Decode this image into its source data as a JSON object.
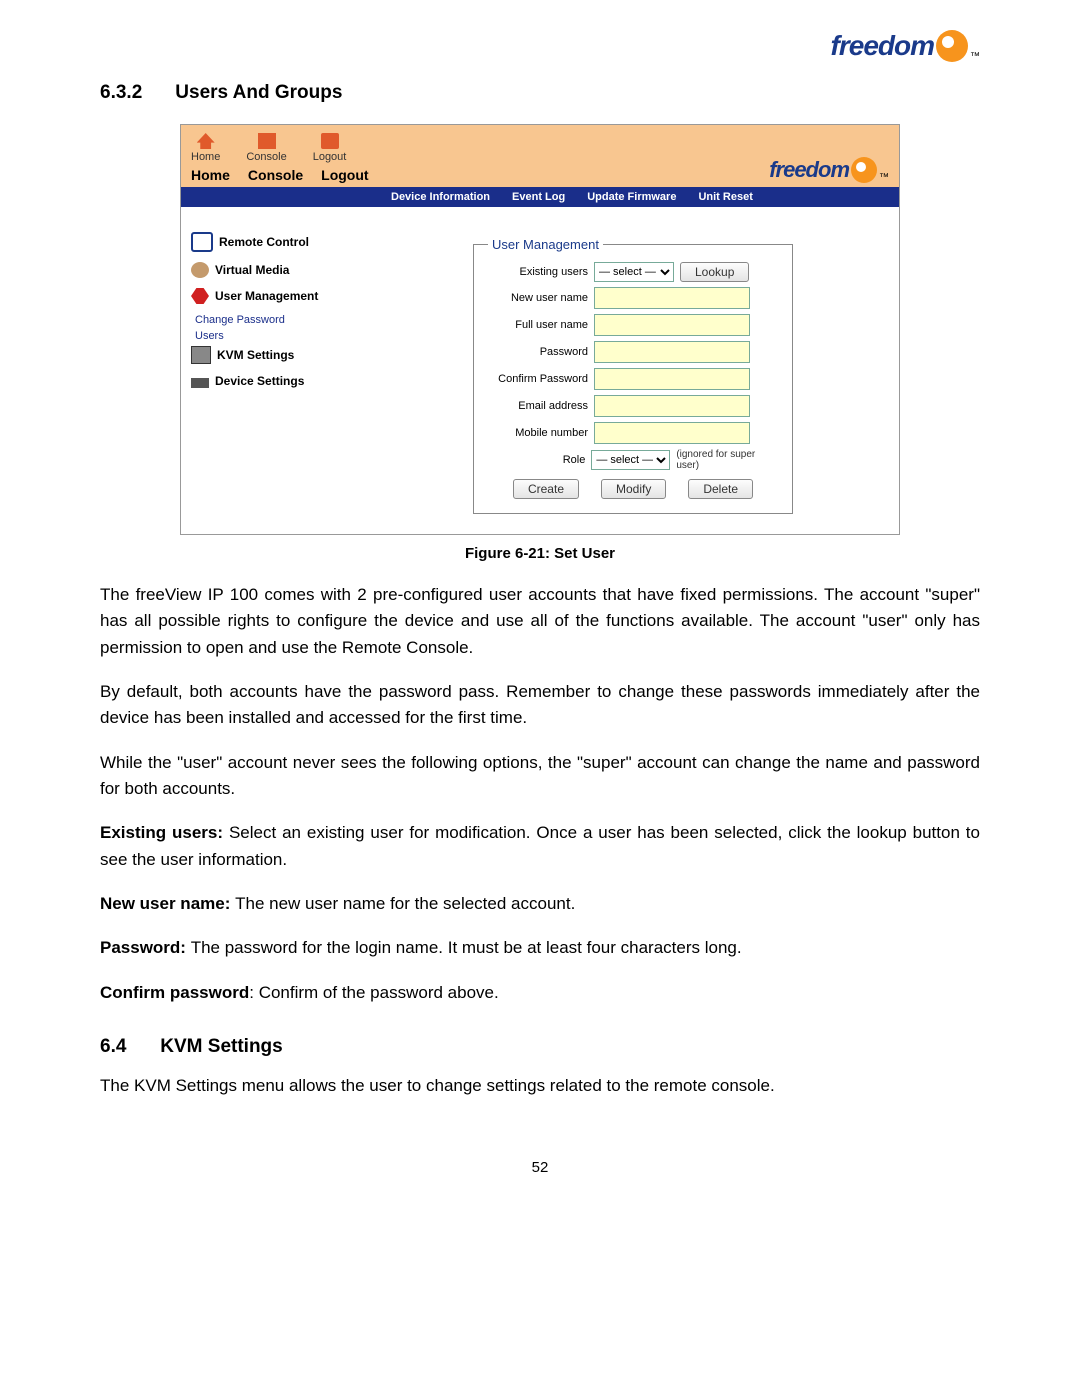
{
  "brand": {
    "name": "freedom",
    "mark": "9",
    "tm": "™"
  },
  "section632": {
    "num": "6.3.2",
    "title": "Users And Groups"
  },
  "screenshot": {
    "nav_icons": [
      {
        "label": "Home"
      },
      {
        "label": "Console"
      },
      {
        "label": "Logout"
      }
    ],
    "nav_labels": [
      "Home",
      "Console",
      "Logout"
    ],
    "tabs": [
      "Device Information",
      "Event Log",
      "Update Firmware",
      "Unit Reset"
    ],
    "sidebar": {
      "remote_control": "Remote Control",
      "virtual_media": "Virtual Media",
      "user_management": "User Management",
      "change_password": "Change Password",
      "users": "Users",
      "kvm_settings": "KVM Settings",
      "device_settings": "Device Settings"
    },
    "form": {
      "legend": "User Management",
      "existing_users_label": "Existing users",
      "select_placeholder": "— select —",
      "lookup_btn": "Lookup",
      "new_user_label": "New user name",
      "full_name_label": "Full user name",
      "password_label": "Password",
      "confirm_pw_label": "Confirm Password",
      "email_label": "Email address",
      "mobile_label": "Mobile number",
      "role_label": "Role",
      "role_note": "(ignored for super user)",
      "create_btn": "Create",
      "modify_btn": "Modify",
      "delete_btn": "Delete"
    }
  },
  "figure_caption": "Figure 6-21: Set User",
  "paragraphs": {
    "p1": "The freeView IP 100 comes with 2 pre-configured user accounts that have fixed permissions. The account \"super\" has all possible rights to configure the device and use all of the functions available. The account \"user\" only has permission to open and use the Remote Console.",
    "p2": "By default, both accounts have the password pass. Remember to change these passwords immediately after the device has been installed and accessed for the first time.",
    "p3": "While the \"user\" account never sees the following options, the \"super\" account can change the name and password for both accounts.",
    "p4_b": "Existing users: ",
    "p4_r": "Select an existing user for modification. Once a user has been selected, click the lookup button to see the user information.",
    "p5_b": "New user name: ",
    "p5_r": "The new user name for the selected account.",
    "p6_b": "Password: ",
    "p6_r": "The password for the login name. It must be at least four characters long.",
    "p7_b": "Confirm password",
    "p7_r": ": Confirm of the password above."
  },
  "section64": {
    "num": "6.4",
    "title": "KVM Settings"
  },
  "p64": "The KVM Settings menu allows the user to change settings related to the remote console.",
  "page_number": "52"
}
